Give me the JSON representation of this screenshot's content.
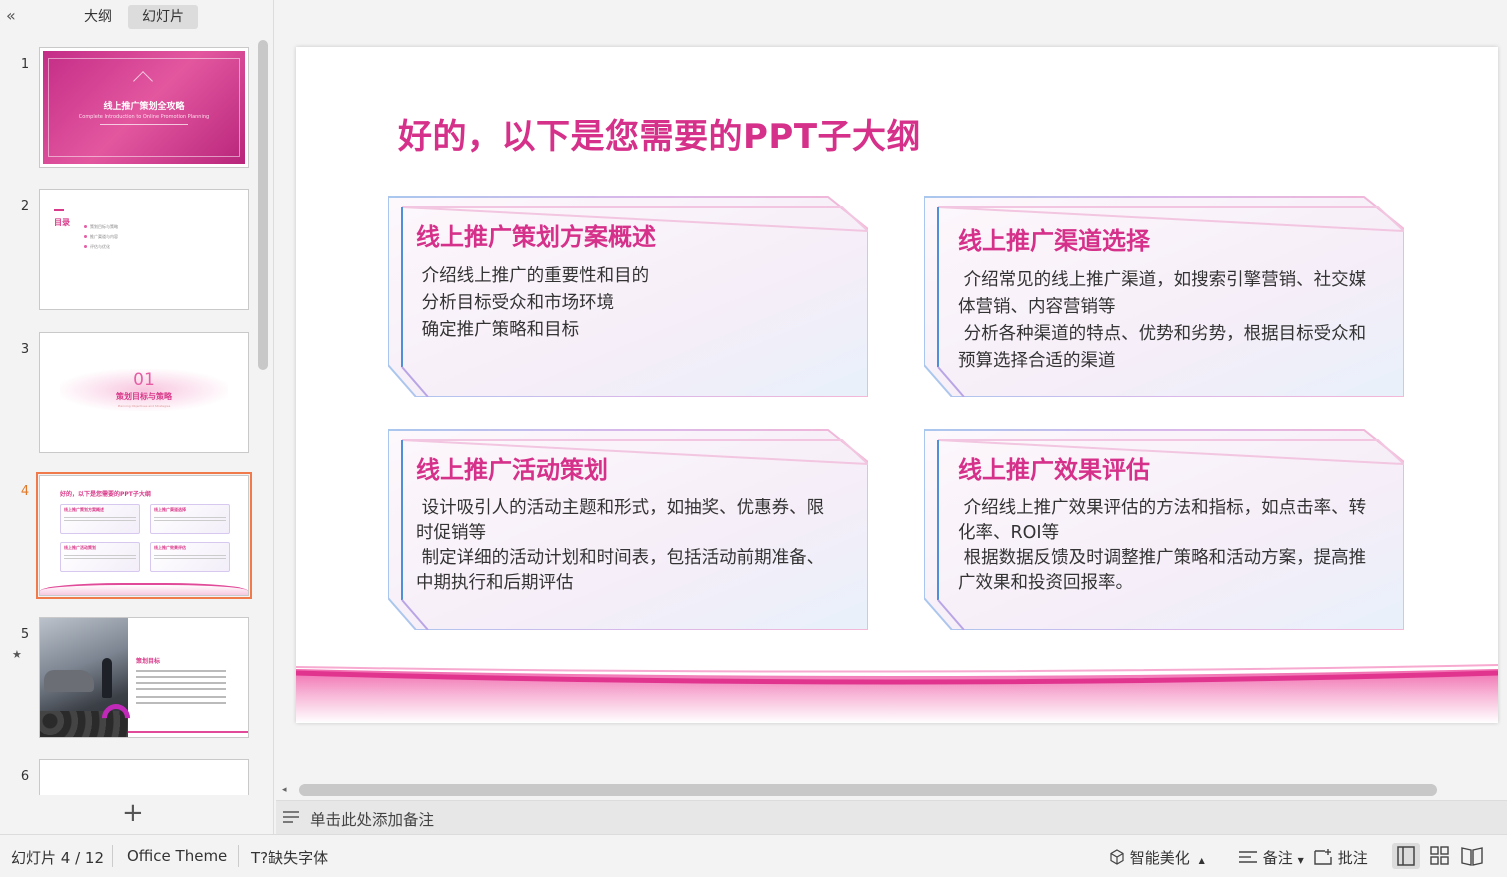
{
  "panel": {
    "tab_outline": "大纲",
    "tab_slides": "幻灯片",
    "thumbnails": [
      {
        "num": "1",
        "title": "线上推广策划全攻略",
        "subtitle": "Complete Introduction to Online Promotion Planning"
      },
      {
        "num": "2",
        "title": "目录",
        "items": [
          "策划目标与策略",
          "推广渠道与内容",
          "评估与优化"
        ]
      },
      {
        "num": "3",
        "number": "01",
        "title": "策划目标与策略",
        "subtitle": "Planning Objectives and Strategies"
      },
      {
        "num": "4",
        "title": "好的，以下是您需要的PPT子大纲",
        "cards": [
          "线上推广策划方案概述",
          "线上推广渠道选择",
          "线上推广活动策划",
          "线上推广效果评估"
        ]
      },
      {
        "num": "5",
        "title": "策划目标"
      },
      {
        "num": "6"
      }
    ],
    "add_icon": "plus-icon"
  },
  "slide": {
    "title": "好的，以下是您需要的PPT子大纲",
    "cards": [
      {
        "title": "线上推广策划方案概述",
        "lines": [
          " 介绍线上推广的重要性和目的",
          " 分析目标受众和市场环境",
          " 确定推广策略和目标"
        ]
      },
      {
        "title": "线上推广渠道选择",
        "lines": [
          " 介绍常见的线上推广渠道，如搜索引擎营销、社交媒体营销、内容营销等",
          " 分析各种渠道的特点、优势和劣势，根据目标受众和预算选择合适的渠道"
        ]
      },
      {
        "title": "线上推广活动策划",
        "lines": [
          " 设计吸引人的活动主题和形式，如抽奖、优惠券、限时促销等",
          " 制定详细的活动计划和时间表，包括活动前期准备、中期执行和后期评估"
        ]
      },
      {
        "title": "线上推广效果评估",
        "lines": [
          " 介绍线上推广效果评估的方法和指标，如点击率、转化率、ROI等",
          " 根据数据反馈及时调整推广策略和活动方案，提高推广效果和投资回报率。"
        ]
      }
    ],
    "accent_color": "#d6318a"
  },
  "notes": {
    "placeholder": "单击此处添加备注"
  },
  "status": {
    "slide_count": "幻灯片 4 / 12",
    "theme": "Office Theme",
    "missing_font": "缺失字体",
    "missing_font_icon": "T?",
    "beautify": "智能美化",
    "notes": "备注",
    "comment": "批注"
  }
}
